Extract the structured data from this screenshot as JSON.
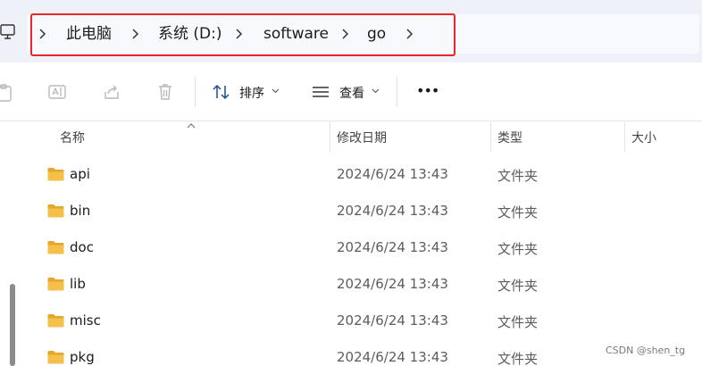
{
  "address_bar": {
    "crumbs": [
      "此电脑",
      "系统 (D:)",
      "software",
      "go"
    ]
  },
  "toolbar": {
    "sort_label": "排序",
    "view_label": "查看",
    "more_label": "•••"
  },
  "columns": {
    "name": "名称",
    "modified": "修改日期",
    "type": "类型",
    "size": "大小"
  },
  "rows": [
    {
      "name": "api",
      "modified": "2024/6/24 13:43",
      "type": "文件夹"
    },
    {
      "name": "bin",
      "modified": "2024/6/24 13:43",
      "type": "文件夹"
    },
    {
      "name": "doc",
      "modified": "2024/6/24 13:43",
      "type": "文件夹"
    },
    {
      "name": "lib",
      "modified": "2024/6/24 13:43",
      "type": "文件夹"
    },
    {
      "name": "misc",
      "modified": "2024/6/24 13:43",
      "type": "文件夹"
    },
    {
      "name": "pkg",
      "modified": "2024/6/24 13:43",
      "type": "文件夹"
    }
  ],
  "watermark": "CSDN @shen_tg",
  "colors": {
    "highlight": "#e8262d",
    "folder": "#f5c04a",
    "folder_dark": "#e4a72c"
  }
}
